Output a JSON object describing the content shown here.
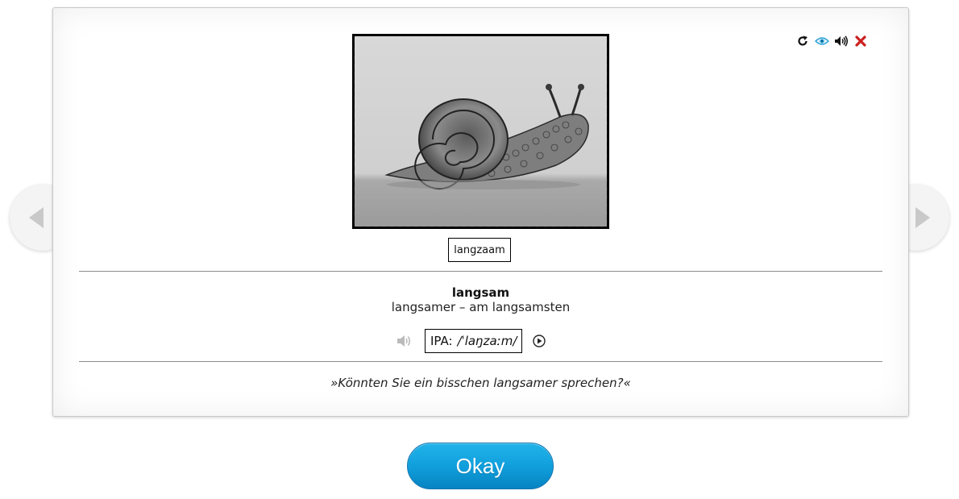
{
  "toolbar": {
    "icons": [
      "refresh-icon",
      "eye-icon",
      "speaker-icon",
      "close-icon"
    ]
  },
  "card": {
    "answer": "langzaam",
    "headword": "langsam",
    "forms": "langsamer – am langsamsten",
    "ipa_prefix": "IPA:",
    "ipa_value": "/ˈlaŋzaːm/",
    "example": "»Könnten Sie ein bisschen langsamer sprechen?«"
  },
  "buttons": {
    "okay_label": "Okay"
  },
  "colors": {
    "okay_button": "#109fdc",
    "close_icon": "#cc1f1f",
    "eye_icon": "#2a9fd8"
  }
}
